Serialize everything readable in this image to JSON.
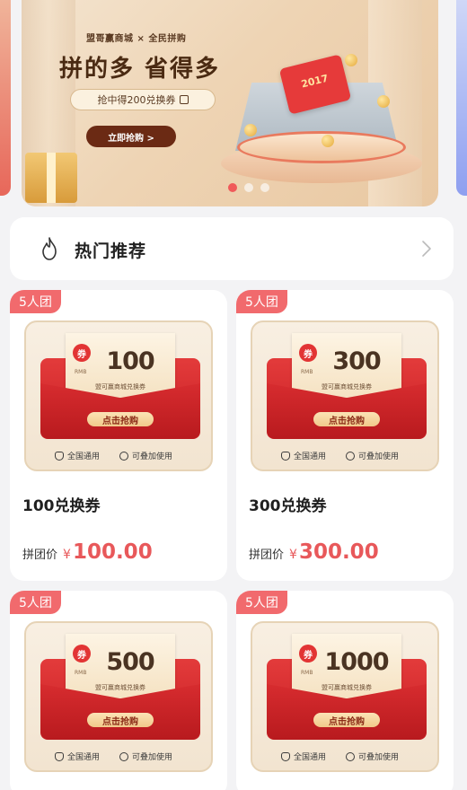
{
  "banner": {
    "brand": "盟哥赢商城 × 全民拼购",
    "headline": "拼的多 省得多",
    "coupon_pill": "抢中得200兑换券",
    "cta": "立即抢购 >",
    "envelope_text": "2017",
    "active_dot_index": 0,
    "dot_count": 3
  },
  "hot": {
    "title": "热门推荐",
    "icon": "flame-icon",
    "chevron": "chevron-right-icon"
  },
  "colors": {
    "accent": "#e8585a",
    "badge": "#f16a6d",
    "banner_cta": "#6b2a14"
  },
  "products": [
    {
      "badge": "5人团",
      "coupon": {
        "juan": "券",
        "rmb": "RMB",
        "amount": "100",
        "subtitle": "盟可赢商城兑换券",
        "button": "点击抢购",
        "feature_left": "全国通用",
        "feature_right": "可叠加使用"
      },
      "title": "100兑换券",
      "price_label": "拼团价",
      "price_symbol": "¥",
      "price": "100.00"
    },
    {
      "badge": "5人团",
      "coupon": {
        "juan": "券",
        "rmb": "RMB",
        "amount": "300",
        "subtitle": "盟可赢商城兑换券",
        "button": "点击抢购",
        "feature_left": "全国通用",
        "feature_right": "可叠加使用"
      },
      "title": "300兑换券",
      "price_label": "拼团价",
      "price_symbol": "¥",
      "price": "300.00"
    },
    {
      "badge": "5人团",
      "coupon": {
        "juan": "券",
        "rmb": "RMB",
        "amount": "500",
        "subtitle": "盟可赢商城兑换券",
        "button": "点击抢购",
        "feature_left": "全国通用",
        "feature_right": "可叠加使用"
      }
    },
    {
      "badge": "5人团",
      "coupon": {
        "juan": "券",
        "rmb": "RMB",
        "amount": "1000",
        "subtitle": "盟可赢商城兑换券",
        "button": "点击抢购",
        "feature_left": "全国通用",
        "feature_right": "可叠加使用"
      }
    }
  ]
}
